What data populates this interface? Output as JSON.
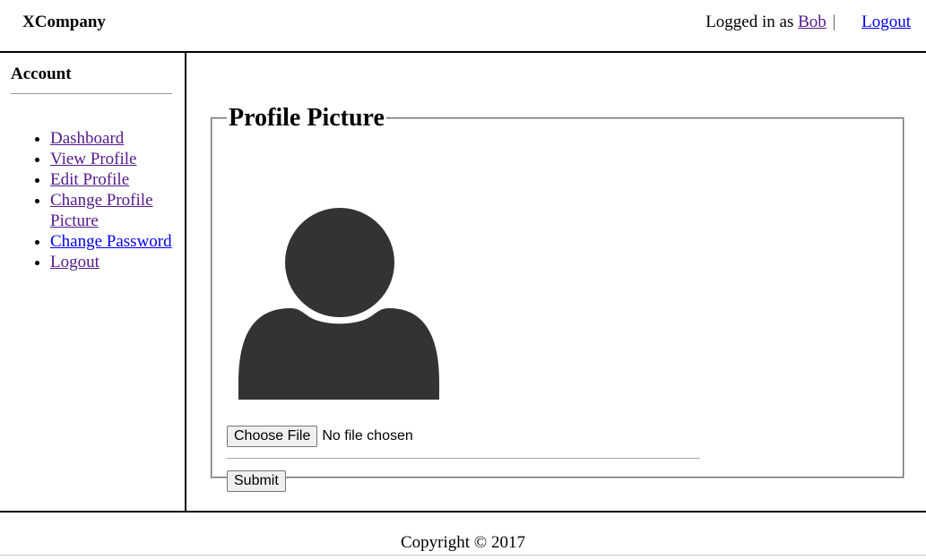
{
  "header": {
    "brand": "XCompany",
    "logged_in_prefix": "Logged in as",
    "username": "Bob",
    "separator": "|",
    "logout_label": "Logout"
  },
  "sidebar": {
    "title": "Account",
    "items": [
      {
        "label": "Dashboard"
      },
      {
        "label": "View Profile"
      },
      {
        "label": "Edit Profile"
      },
      {
        "label": "Change Profile Picture"
      },
      {
        "label": "Change Password"
      },
      {
        "label": "Logout"
      }
    ]
  },
  "main": {
    "legend": "Profile Picture",
    "avatar_icon": "user-silhouette-icon",
    "choose_file_label": "Choose File",
    "file_status": "No file chosen",
    "submit_label": "Submit"
  },
  "footer": {
    "copyright": "Copyright © 2017"
  },
  "colors": {
    "visited_link": "#551a8b",
    "unvisited_link": "#0000ee",
    "avatar_fill": "#333333"
  }
}
